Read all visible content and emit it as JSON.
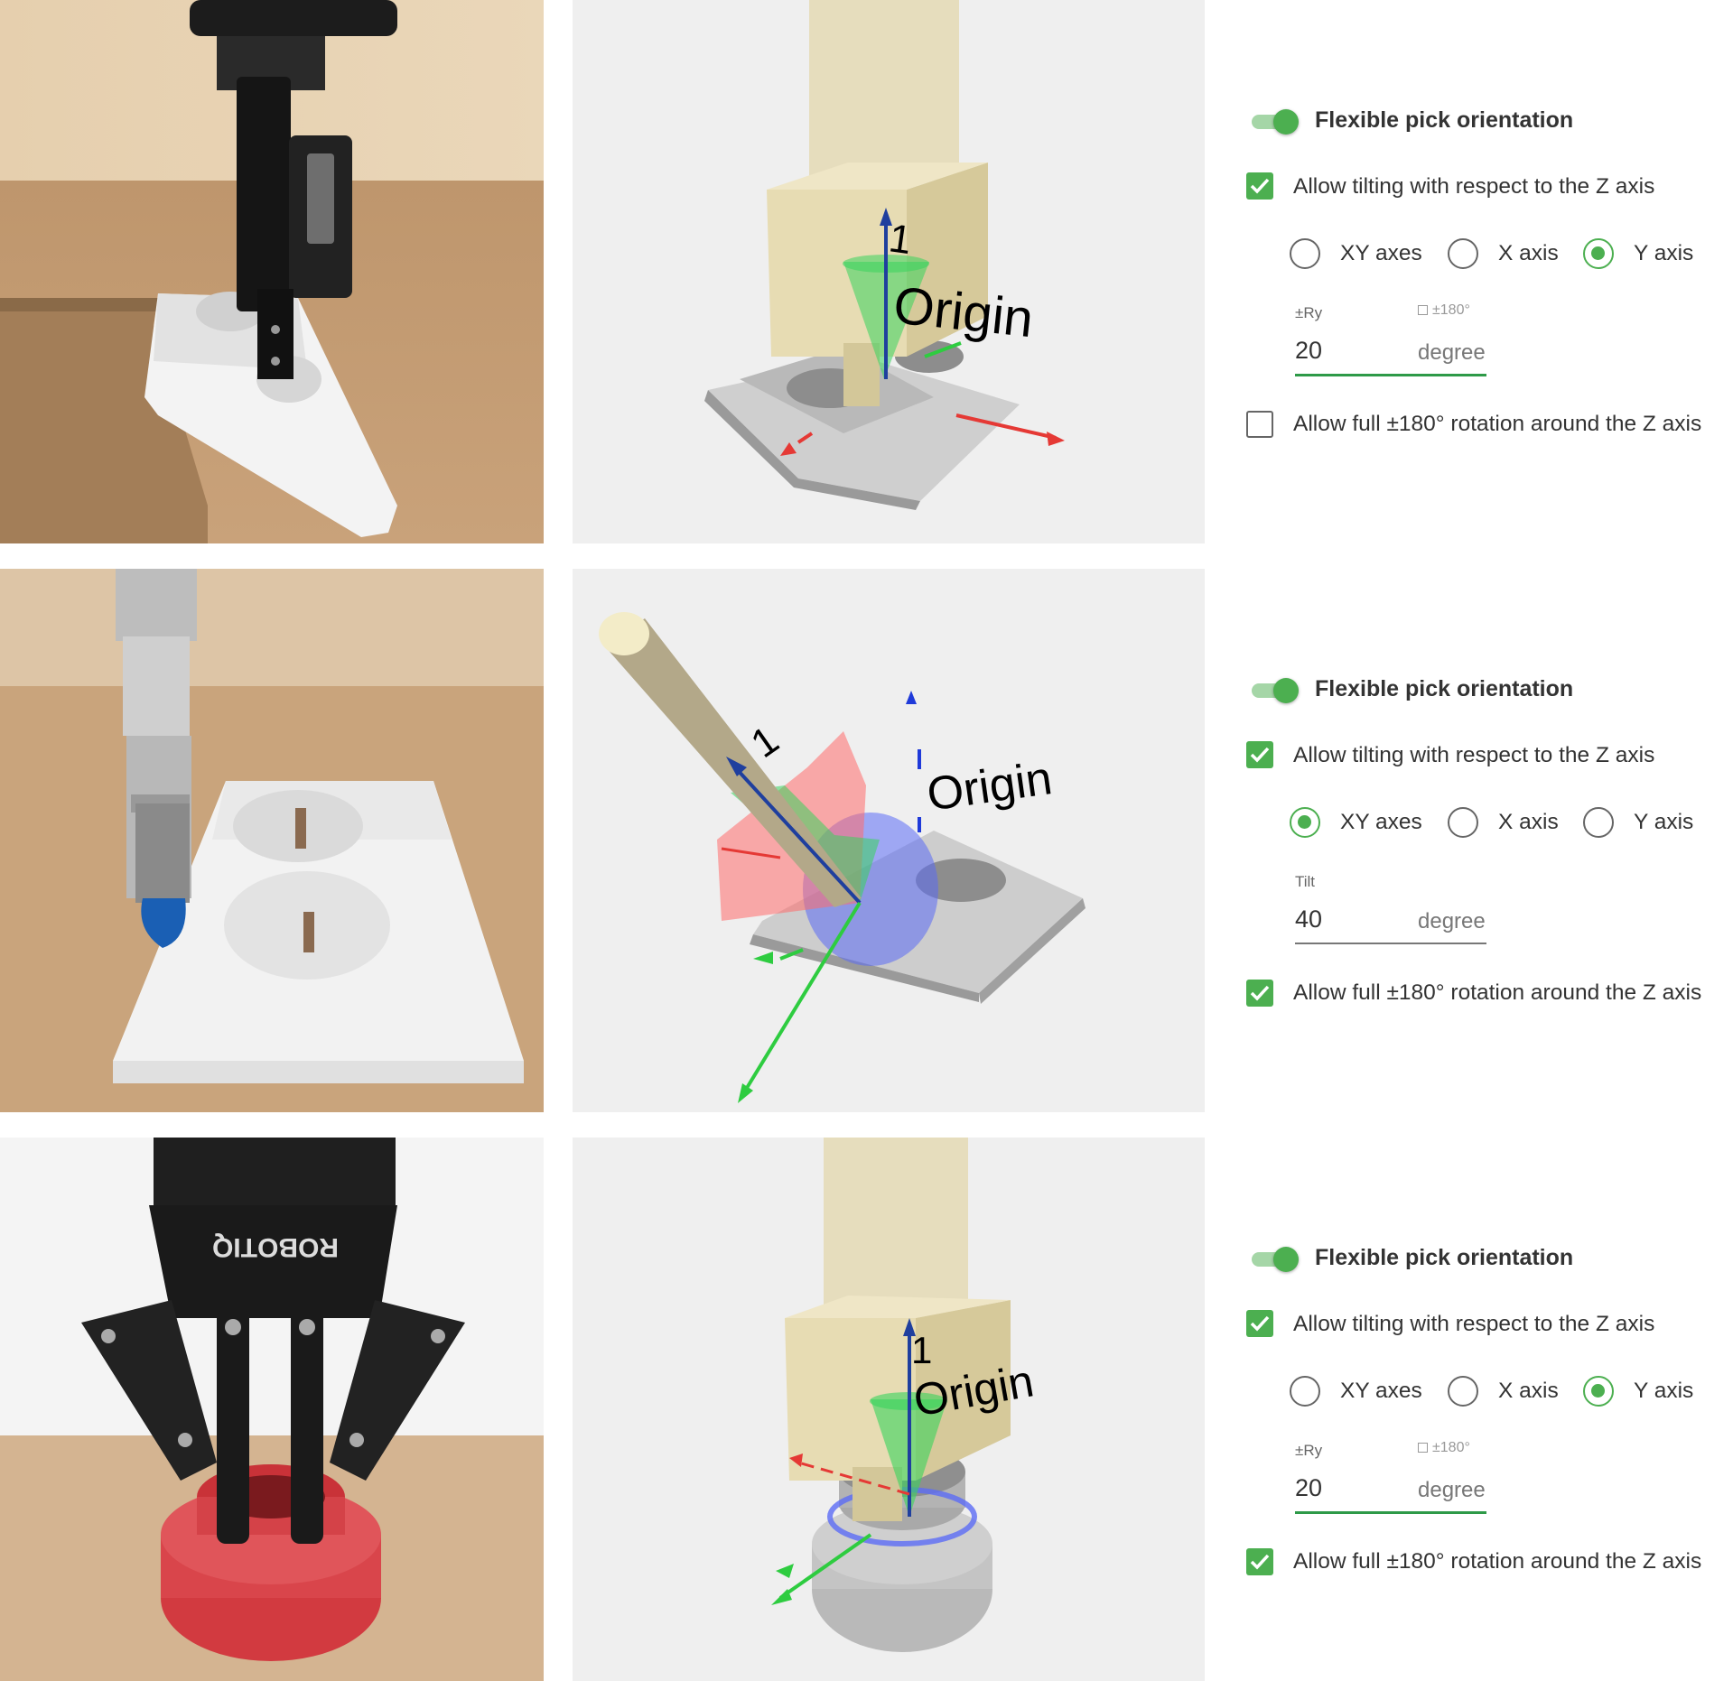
{
  "colors": {
    "accent_green": "#4caf50",
    "toggle_track": "#a5d6a7",
    "viewport_bg": "#efefef",
    "axis_x": "#e53935",
    "axis_y": "#2ecc40",
    "axis_z": "#1f3f9e",
    "tool_beige": "#e8dcb0"
  },
  "rows": [
    {
      "photo_icon": "gripper-on-tilted-socket-photo",
      "viewport": {
        "origin_label": "Origin",
        "tool_number": "1"
      },
      "settings": {
        "toggle": {
          "label": "Flexible pick orientation",
          "on": true
        },
        "tilt_checkbox": {
          "label": "Allow tilting with respect to the Z axis",
          "checked": true
        },
        "axes": [
          {
            "label": "XY axes",
            "selected": false
          },
          {
            "label": "X axis",
            "selected": false
          },
          {
            "label": "Y axis",
            "selected": true
          }
        ],
        "field": {
          "label": "±Ry",
          "mini_check": "±180°",
          "value": "20",
          "unit": "degree",
          "focused": true
        },
        "rotation_checkbox": {
          "label": "Allow full ±180° rotation around the Z axis",
          "checked": false
        }
      }
    },
    {
      "photo_icon": "suction-cup-on-socket-photo",
      "viewport": {
        "origin_label": "Origin",
        "tool_number": "1"
      },
      "settings": {
        "toggle": {
          "label": "Flexible pick orientation",
          "on": true
        },
        "tilt_checkbox": {
          "label": "Allow tilting with respect to the Z axis",
          "checked": true
        },
        "axes": [
          {
            "label": "XY axes",
            "selected": true
          },
          {
            "label": "X axis",
            "selected": false
          },
          {
            "label": "Y axis",
            "selected": false
          }
        ],
        "field": {
          "label": "Tilt",
          "mini_check": "",
          "value": "40",
          "unit": "degree",
          "focused": false
        },
        "rotation_checkbox": {
          "label": "Allow full ±180° rotation around the Z axis",
          "checked": true
        }
      }
    },
    {
      "photo_icon": "robotiq-gripper-on-red-part-photo",
      "photo_logo_text": "ROBOTIQ",
      "viewport": {
        "origin_label": "Origin",
        "tool_number": "1"
      },
      "settings": {
        "toggle": {
          "label": "Flexible pick orientation",
          "on": true
        },
        "tilt_checkbox": {
          "label": "Allow tilting with respect to the Z axis",
          "checked": true
        },
        "axes": [
          {
            "label": "XY axes",
            "selected": false
          },
          {
            "label": "X axis",
            "selected": false
          },
          {
            "label": "Y axis",
            "selected": true
          }
        ],
        "field": {
          "label": "±Ry",
          "mini_check": "±180°",
          "value": "20",
          "unit": "degree",
          "focused": true
        },
        "rotation_checkbox": {
          "label": "Allow full ±180° rotation around the Z axis",
          "checked": true
        }
      }
    }
  ]
}
